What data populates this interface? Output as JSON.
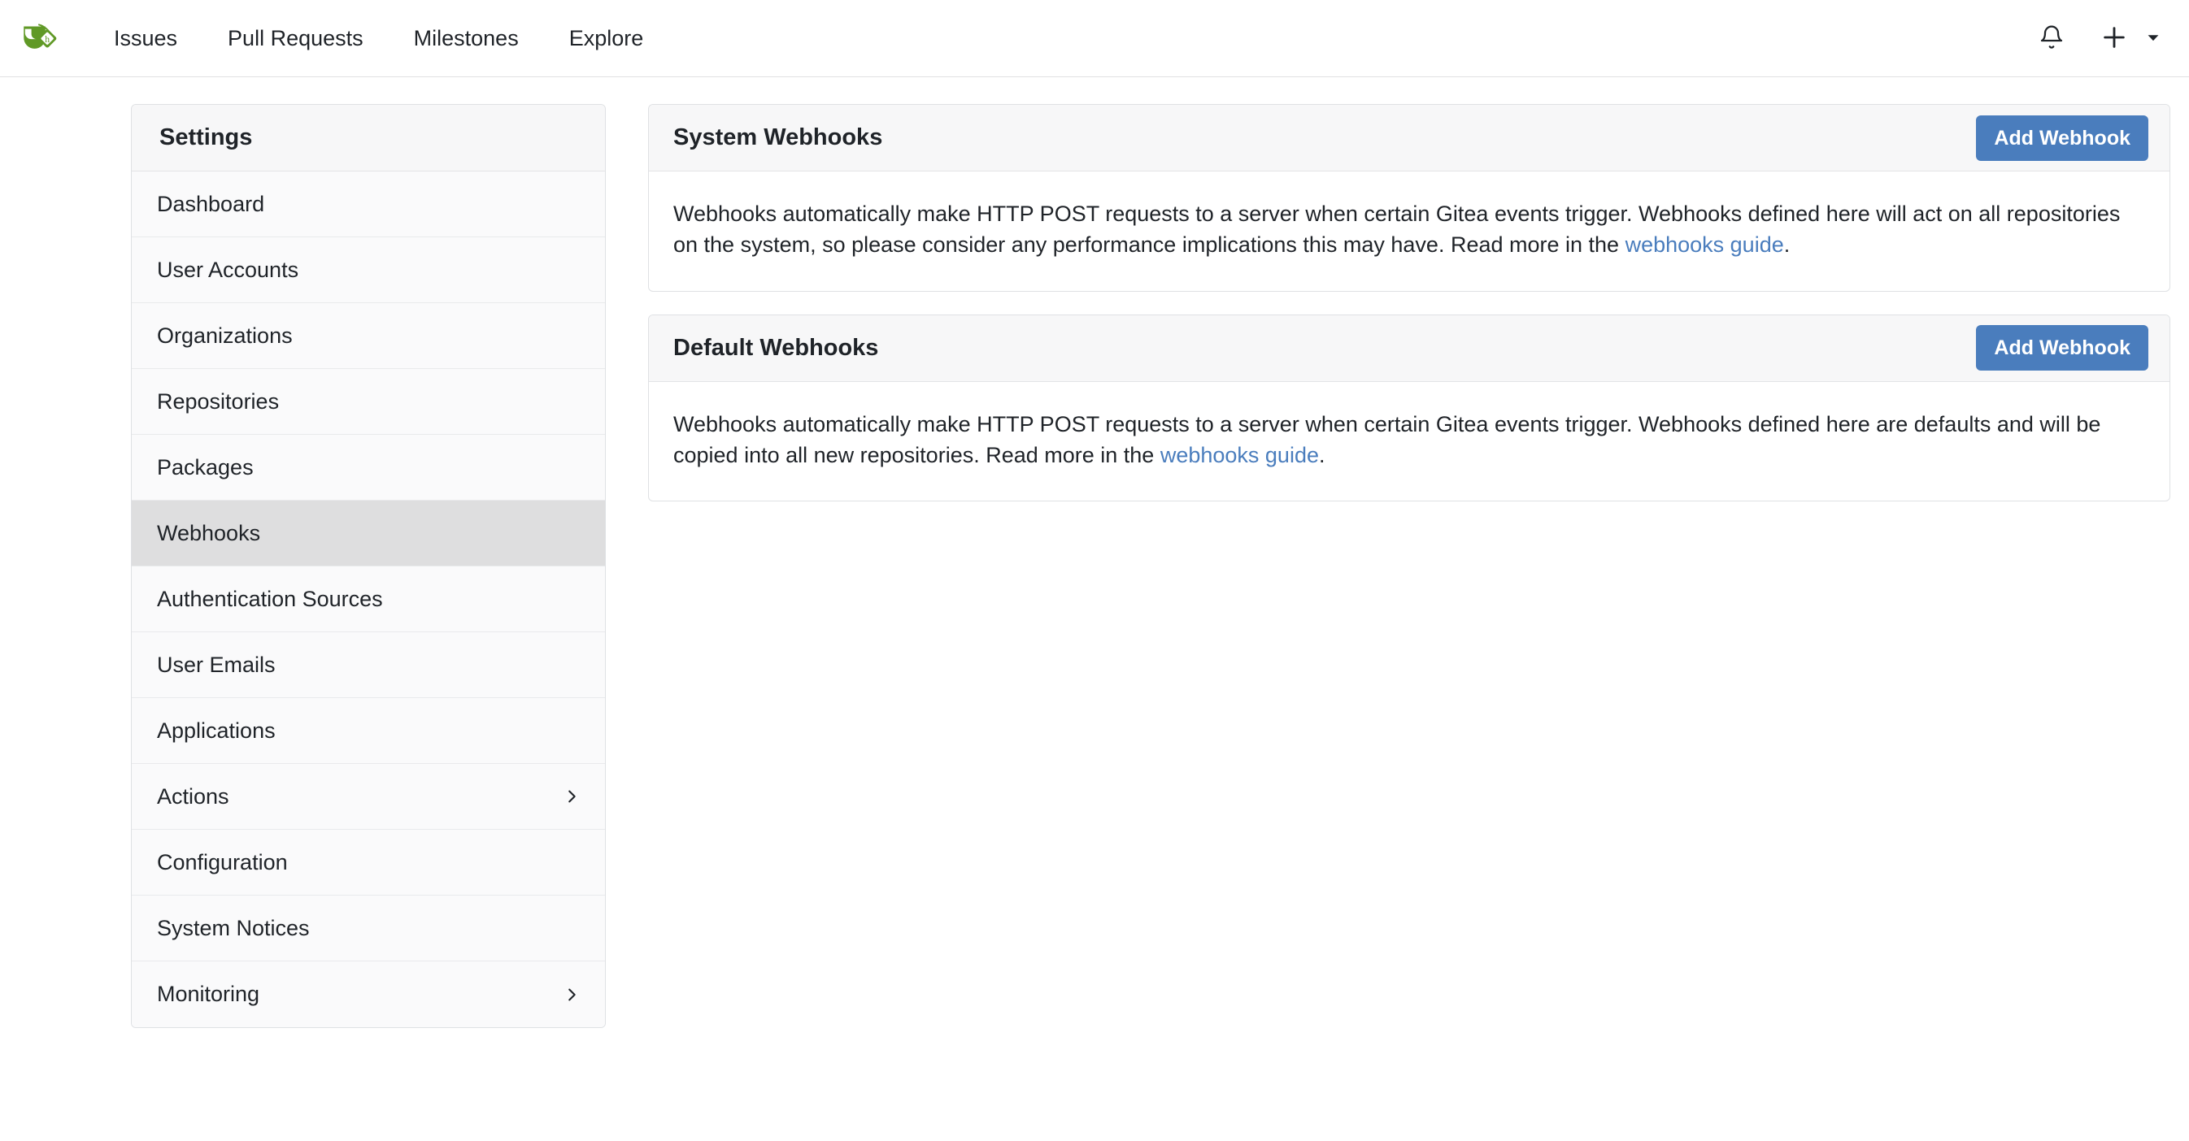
{
  "navbar": {
    "logo_icon": "gitea-teacup-logo",
    "links": [
      {
        "label": "Issues"
      },
      {
        "label": "Pull Requests"
      },
      {
        "label": "Milestones"
      },
      {
        "label": "Explore"
      }
    ],
    "notifications_icon": "bell-icon",
    "create_icon": "plus-icon",
    "create_caret_icon": "chevron-down-icon"
  },
  "sidebar": {
    "title": "Settings",
    "items": [
      {
        "label": "Dashboard",
        "active": false,
        "chevron": false
      },
      {
        "label": "User Accounts",
        "active": false,
        "chevron": false
      },
      {
        "label": "Organizations",
        "active": false,
        "chevron": false
      },
      {
        "label": "Repositories",
        "active": false,
        "chevron": false
      },
      {
        "label": "Packages",
        "active": false,
        "chevron": false
      },
      {
        "label": "Webhooks",
        "active": true,
        "chevron": false
      },
      {
        "label": "Authentication Sources",
        "active": false,
        "chevron": false
      },
      {
        "label": "User Emails",
        "active": false,
        "chevron": false
      },
      {
        "label": "Applications",
        "active": false,
        "chevron": false
      },
      {
        "label": "Actions",
        "active": false,
        "chevron": true
      },
      {
        "label": "Configuration",
        "active": false,
        "chevron": false
      },
      {
        "label": "System Notices",
        "active": false,
        "chevron": false
      },
      {
        "label": "Monitoring",
        "active": false,
        "chevron": true
      }
    ]
  },
  "main": {
    "panels": [
      {
        "title": "System Webhooks",
        "button_label": "Add Webhook",
        "text_before_link": "Webhooks automatically make HTTP POST requests to a server when certain Gitea events trigger. Webhooks defined here will act on all repositories on the system, so please consider any performance implications this may have. Read more in the ",
        "link_label": "webhooks guide",
        "text_after_link": "."
      },
      {
        "title": "Default Webhooks",
        "button_label": "Add Webhook",
        "text_before_link": "Webhooks automatically make HTTP POST requests to a server when certain Gitea events trigger. Webhooks defined here are defaults and will be copied into all new repositories. Read more in the ",
        "link_label": "webhooks guide",
        "text_after_link": "."
      }
    ]
  },
  "colors": {
    "primary_blue": "#4a7dbd",
    "link_blue": "#4a7dbd",
    "logo_green": "#609926",
    "active_item_gray": "#dededf",
    "panel_header_gray": "#f7f7f8",
    "border_gray": "#dfe1e4",
    "text_dark": "#1f2328"
  }
}
